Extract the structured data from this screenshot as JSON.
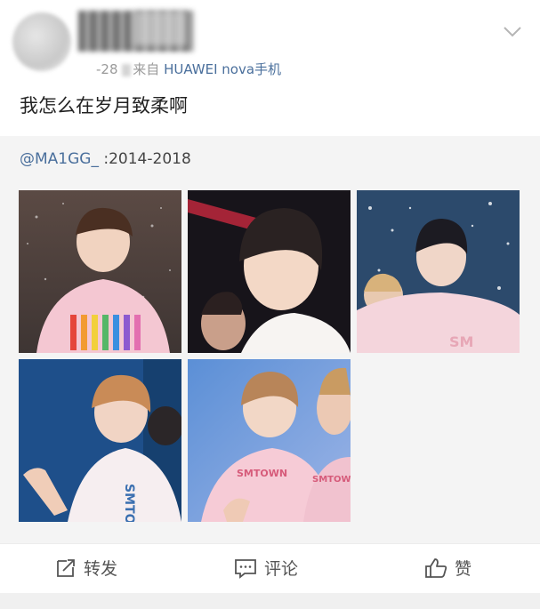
{
  "post": {
    "timestamp_fragment": "-28",
    "source_prefix": "来自",
    "source_device": "HUAWEI nova手机",
    "text": "我怎么在岁月致柔啊"
  },
  "repost": {
    "mention": "@MA1GG_",
    "text": " :2014-2018",
    "photos": [
      {
        "name": "photo-1",
        "theme": "pink-shirt-rainbow-stripes"
      },
      {
        "name": "photo-2",
        "theme": "dark-stage-side-profile"
      },
      {
        "name": "photo-3",
        "theme": "blue-confetti-stage"
      },
      {
        "name": "photo-4",
        "theme": "blue-stage-waving"
      },
      {
        "name": "photo-5",
        "theme": "blue-stage-smtown-shirt"
      }
    ]
  },
  "actions": {
    "repost_label": "转发",
    "comment_label": "评论",
    "like_label": "赞"
  },
  "icons": {
    "menu": "chevron-down-icon",
    "repost": "share-icon",
    "comment": "comment-icon",
    "like": "thumbs-up-icon"
  },
  "colors": {
    "link": "#4a6f9c",
    "meta": "#9a9a9a",
    "repost_bg": "#f4f4f4"
  }
}
